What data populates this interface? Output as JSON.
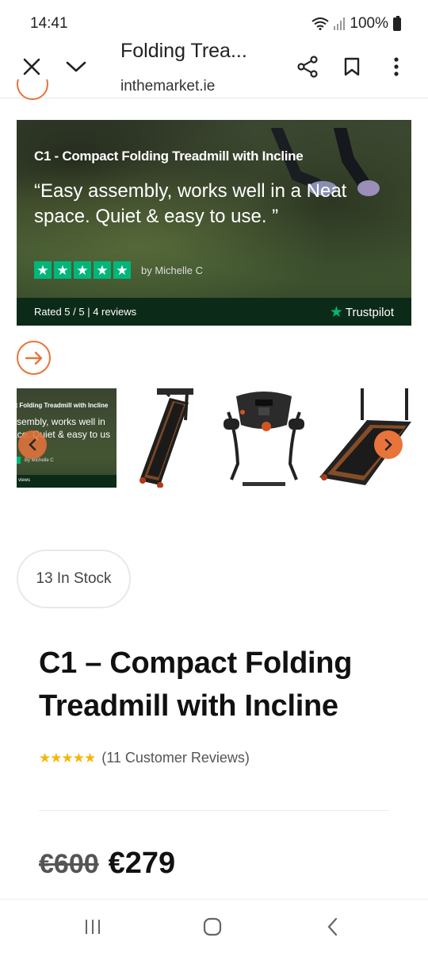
{
  "status_bar": {
    "time": "14:41",
    "battery": "100%"
  },
  "header": {
    "title": "Folding Trea...",
    "url": "inthemarket.ie"
  },
  "banner": {
    "title": "C1 - Compact Folding Treadmill with Incline",
    "quote": "“Easy assembly, works well in a Neat space. Quiet & easy to use. ”",
    "reviewer": "by Michelle C",
    "rated": "Rated 5 / 5 | 4 reviews",
    "trustpilot": "Trustpilot",
    "stars": 5
  },
  "thumbs": {
    "t1_title": "ct Folding Treadmill with Incline",
    "t1_quote_line1": "ssembly, works well in",
    "t1_quote_line2": "ace. Quiet & easy to us",
    "t1_by": "By Michelle C",
    "t1_foot": "views"
  },
  "stock": {
    "label": "13 In Stock"
  },
  "product": {
    "title": "C1 – Compact Folding Treadmill with Incline",
    "rating_stars": "★★★★★",
    "reviews": "(11 Customer Reviews)",
    "old_price": "€600",
    "new_price": "€279"
  },
  "colors": {
    "accent": "#e8743b",
    "trustpilot_green": "#00b67a",
    "star_gold": "#f5b50a"
  }
}
